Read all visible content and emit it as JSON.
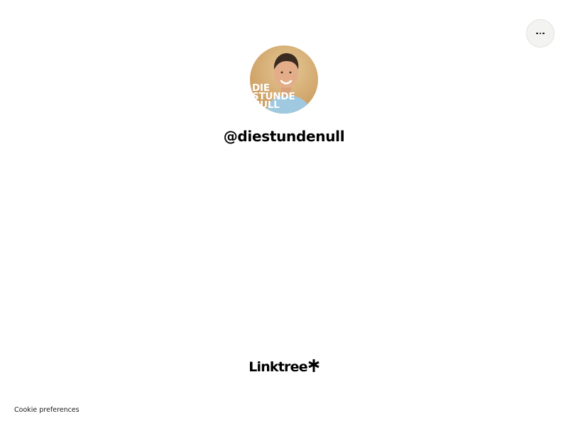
{
  "header": {
    "menu_icon": "more-horizontal-icon"
  },
  "profile": {
    "avatar_lines": [
      "DIE",
      "STUNDE",
      "NULL"
    ],
    "username": "@diestundenull"
  },
  "footer": {
    "brand_name": "Linktree",
    "brand_icon": "linktree-asterisk-icon",
    "cookie_label": "Cookie preferences"
  },
  "colors": {
    "background": "#ffffff",
    "menu_button_bg": "#f3f3f1",
    "avatar_bg": "#d9b57a",
    "shirt": "#9ec9e0",
    "text": "#000000"
  }
}
